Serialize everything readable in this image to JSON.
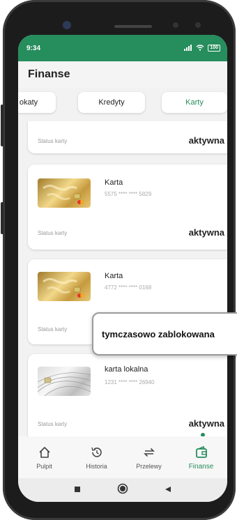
{
  "status_bar": {
    "time": "9:34",
    "signal": "5d",
    "battery": "100"
  },
  "header": {
    "title": "Finanse"
  },
  "tabs": [
    {
      "label": "okaty",
      "active": false
    },
    {
      "label": "Kredyty",
      "active": false
    },
    {
      "label": "Karty",
      "active": true
    }
  ],
  "cards": [
    {
      "status_label": "Status karty",
      "status_value": "aktywna"
    },
    {
      "name": "Karta",
      "number": "5575 **** **** 5829",
      "status_label": "Status karty",
      "status_value": "aktywna"
    },
    {
      "name": "Karta",
      "number": "4772 **** **** 0168",
      "status_label": "Status karty",
      "status_value": "tymczasowo zablokowana"
    },
    {
      "name": "karta lokalna",
      "number": "1231 **** **** 26940",
      "status_label": "Status karty",
      "status_value": "aktywna"
    }
  ],
  "bottom_nav": [
    {
      "label": "Pulpit",
      "icon": "home-icon",
      "active": false
    },
    {
      "label": "Historia",
      "icon": "history-icon",
      "active": false
    },
    {
      "label": "Przelewy",
      "icon": "transfer-icon",
      "active": false
    },
    {
      "label": "Finanse",
      "icon": "wallet-icon",
      "active": true
    }
  ],
  "colors": {
    "accent": "#268d5c"
  }
}
